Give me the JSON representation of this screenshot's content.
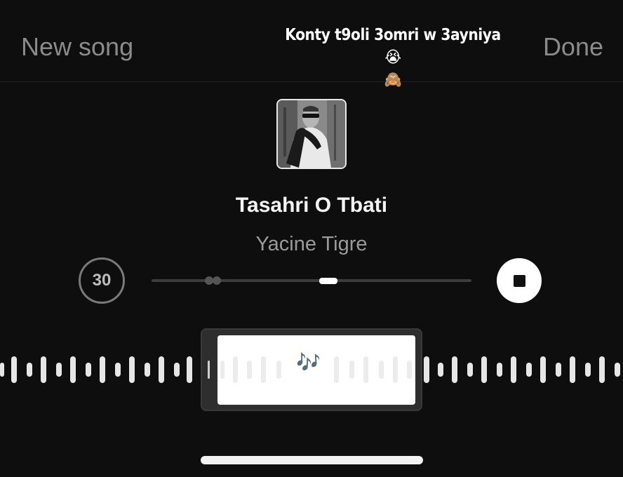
{
  "header": {
    "new_song_label": "New song",
    "done_label": "Done",
    "caption_line1": "Konty t9oli 3omri w 3ayniya 😭",
    "caption_line2": "🙈"
  },
  "song": {
    "title": "Tasahri O Tbati",
    "artist": "Yacine Tigre",
    "cover_icon": "album-cover-photo"
  },
  "controls": {
    "skip_label": "30",
    "stop_icon": "stop-icon"
  },
  "selector": {
    "notes_emoji": "🎶"
  },
  "colors": {
    "background": "#0e0e0e",
    "muted_text": "#8b8b8b",
    "accent_white": "#ffffff"
  }
}
